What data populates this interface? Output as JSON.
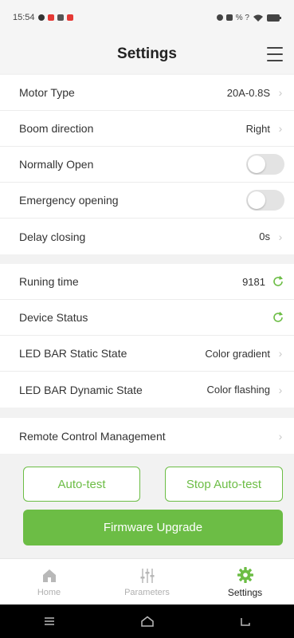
{
  "status_bar": {
    "time": "15:54",
    "right_text": "% ?"
  },
  "header": {
    "title": "Settings"
  },
  "group1": [
    {
      "label": "Motor Type",
      "value": "20A-0.8S"
    },
    {
      "label": "Boom direction",
      "value": "Right"
    },
    {
      "label": "Normally Open"
    },
    {
      "label": "Emergency opening"
    },
    {
      "label": "Delay closing",
      "value": "0s"
    }
  ],
  "group2": [
    {
      "label": "Runing time",
      "value": "9181"
    },
    {
      "label": "Device Status"
    },
    {
      "label": "LED BAR Static State",
      "value": "Color gradient"
    },
    {
      "label": "LED BAR Dynamic State",
      "value": "Color flashing"
    }
  ],
  "group3": [
    {
      "label": "Remote Control Management"
    }
  ],
  "buttons": {
    "auto_test": "Auto-test",
    "stop_auto_test": "Stop Auto-test",
    "firmware_upgrade": "Firmware Upgrade"
  },
  "nav": {
    "home": "Home",
    "parameters": "Parameters",
    "settings": "Settings"
  },
  "colors": {
    "accent": "#6cbd45",
    "toggle_off": "#e3e3e3"
  }
}
